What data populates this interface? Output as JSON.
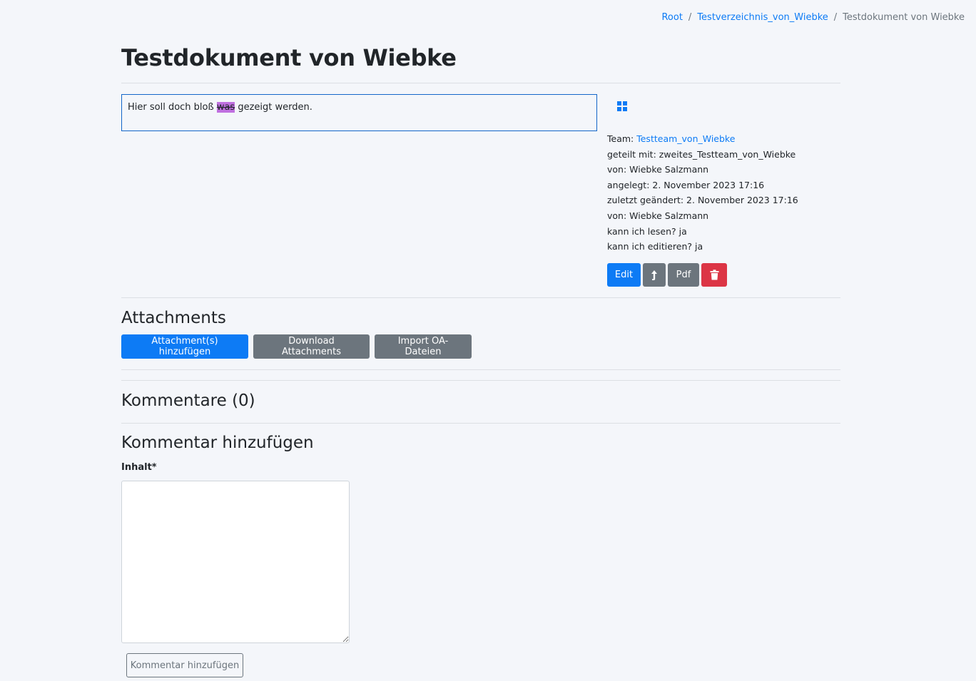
{
  "breadcrumb": {
    "root": "Root",
    "folder": "Testverzeichnis_von_Wiebke",
    "current": "Testdokument von Wiebke"
  },
  "document": {
    "title": "Testdokument von Wiebke",
    "content_before": "Hier soll doch bloß ",
    "content_marked": "was",
    "content_after": " gezeigt werden."
  },
  "meta": {
    "team_label": "Team: ",
    "team_value": "Testteam_von_Wiebke",
    "shared": "geteilt mit: zweites_Testteam_von_Wiebke",
    "author": "von: Wiebke Salzmann",
    "created": "angelegt: 2. November 2023 17:16",
    "modified": "zuletzt geändert: 2. November 2023 17:16",
    "modified_by": "von: Wiebke Salzmann",
    "can_read": "kann ich lesen? ja",
    "can_edit": "kann ich editieren? ja"
  },
  "actions": {
    "edit": "Edit",
    "pdf": "Pdf",
    "move_icon": "arrow-up-icon",
    "delete_icon": "trash-icon"
  },
  "attachments": {
    "heading": "Attachments",
    "add": "Attachment(s) hinzufügen",
    "download": "Download Attachments",
    "import": "Import OA-Dateien"
  },
  "comments": {
    "heading": "Kommentare (0)",
    "add_heading": "Kommentar hinzufügen",
    "content_label": "Inhalt*",
    "submit": "Kommentar hinzufügen"
  },
  "colors": {
    "primary": "#0d7bf5",
    "secondary": "#6c757d",
    "danger": "#dc3545",
    "highlight": "#c070e0"
  }
}
